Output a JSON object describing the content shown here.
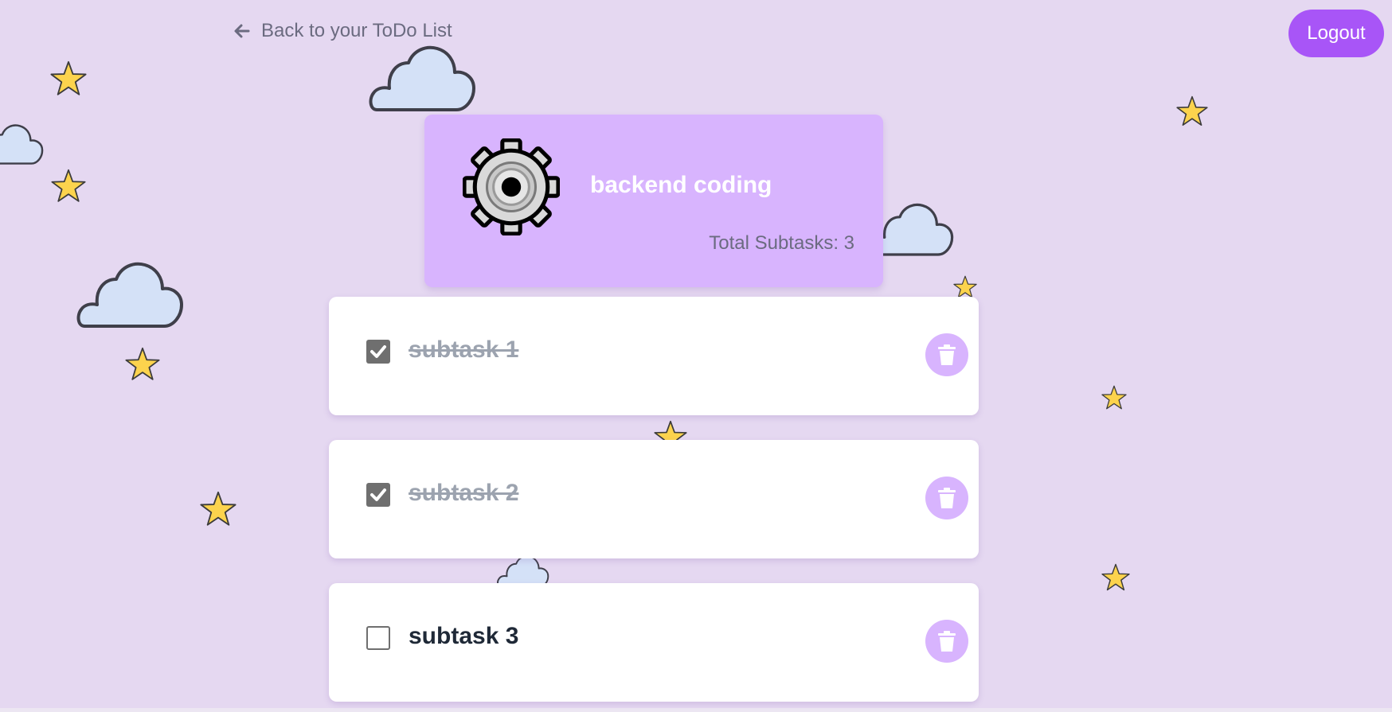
{
  "nav": {
    "back_label": "Back to your ToDo List",
    "logout_label": "Logout"
  },
  "task": {
    "title": "backend coding",
    "icon": "gear-icon",
    "total_subtasks_label": "Total Subtasks: 3"
  },
  "subtasks": [
    {
      "label": "subtask 1",
      "completed": true
    },
    {
      "label": "subtask 2",
      "completed": true
    },
    {
      "label": "subtask 3",
      "completed": false
    }
  ],
  "colors": {
    "background": "#e5d8f1",
    "accent": "#a855f7",
    "card": "#d8b4fe",
    "star": "#fcd34d",
    "cloud": "#d4e1f7"
  }
}
